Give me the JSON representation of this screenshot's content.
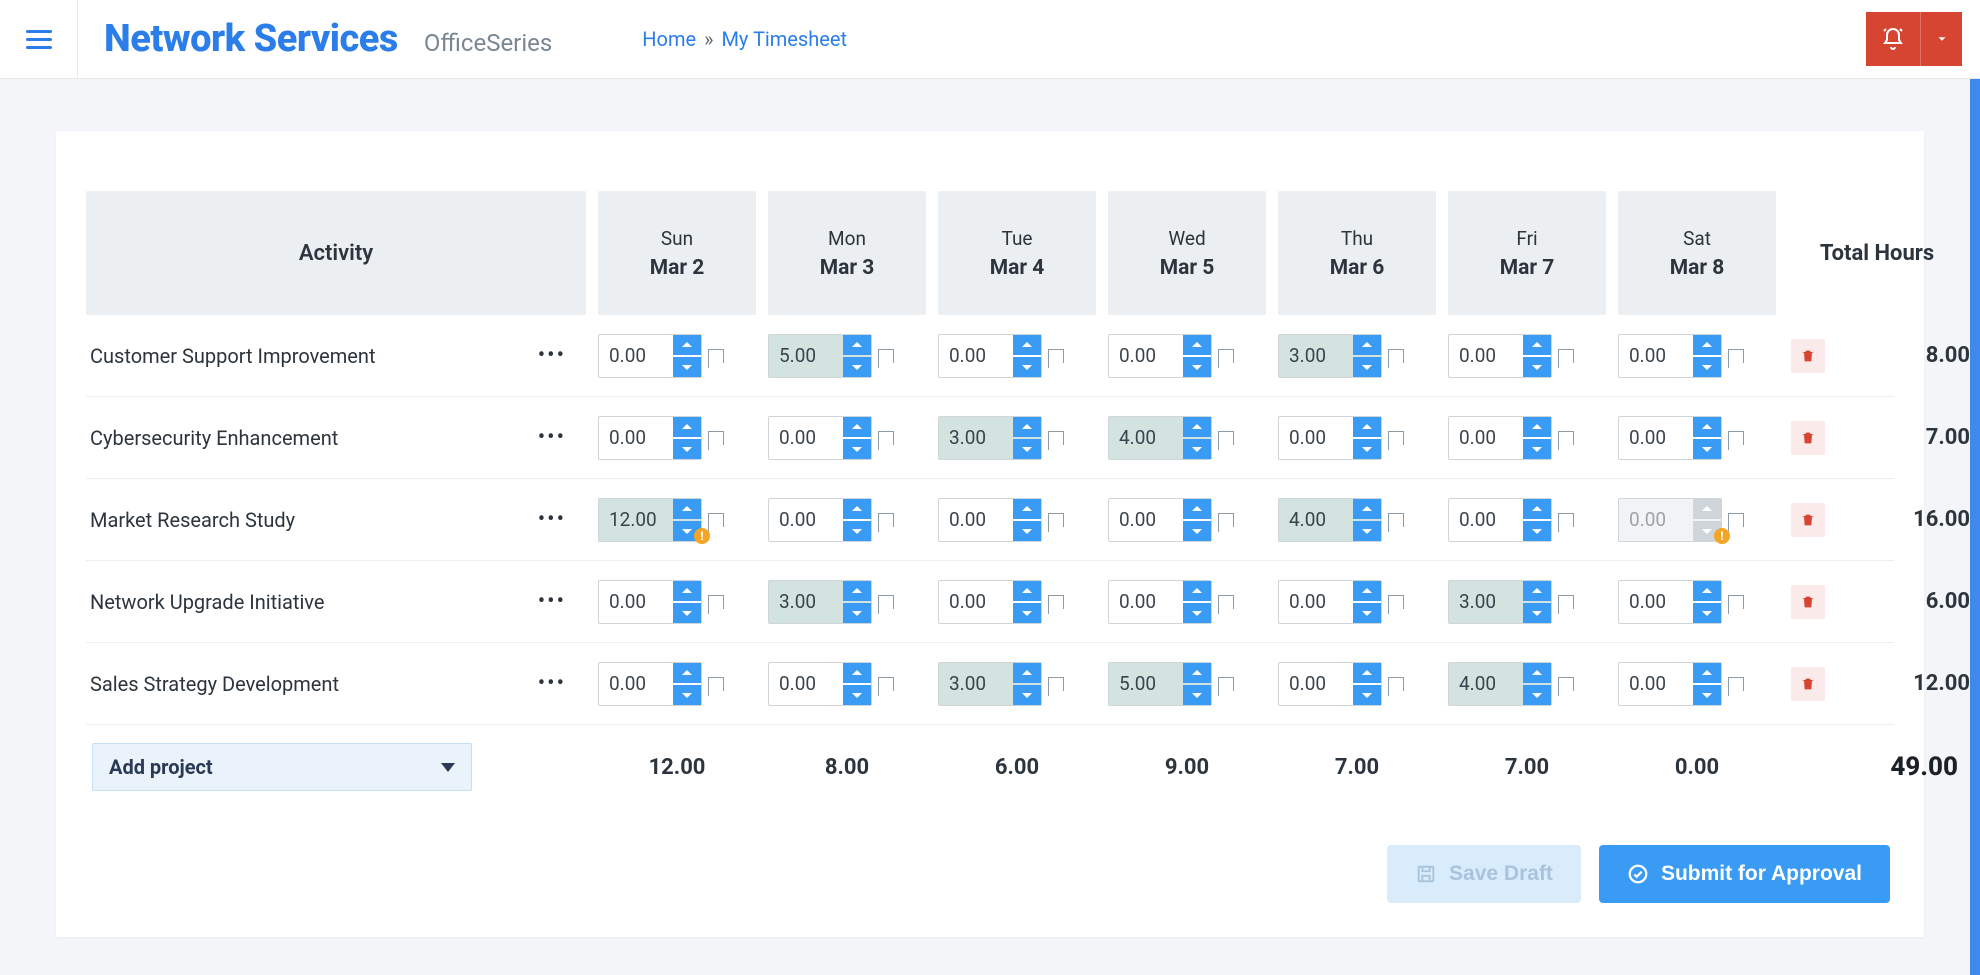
{
  "header": {
    "brand_main": "Network Services",
    "brand_sub": "OfficeSeries",
    "breadcrumb": {
      "home": "Home",
      "sep": "»",
      "current": "My Timesheet"
    }
  },
  "table": {
    "activity_header": "Activity",
    "total_header": "Total Hours",
    "days": [
      {
        "dow": "Sun",
        "date": "Mar 2"
      },
      {
        "dow": "Mon",
        "date": "Mar 3"
      },
      {
        "dow": "Tue",
        "date": "Mar 4"
      },
      {
        "dow": "Wed",
        "date": "Mar 5"
      },
      {
        "dow": "Thu",
        "date": "Mar 6"
      },
      {
        "dow": "Fri",
        "date": "Mar 7"
      },
      {
        "dow": "Sat",
        "date": "Mar 8"
      }
    ],
    "rows": [
      {
        "name": "Customer Support Improvement",
        "cells": [
          {
            "v": "0.00",
            "filled": false,
            "disabled": false,
            "warn": false
          },
          {
            "v": "5.00",
            "filled": true,
            "disabled": false,
            "warn": false
          },
          {
            "v": "0.00",
            "filled": false,
            "disabled": false,
            "warn": false
          },
          {
            "v": "0.00",
            "filled": false,
            "disabled": false,
            "warn": false
          },
          {
            "v": "3.00",
            "filled": true,
            "disabled": false,
            "warn": false
          },
          {
            "v": "0.00",
            "filled": false,
            "disabled": false,
            "warn": false
          },
          {
            "v": "0.00",
            "filled": false,
            "disabled": false,
            "warn": false
          }
        ],
        "total": "8.00"
      },
      {
        "name": "Cybersecurity Enhancement",
        "cells": [
          {
            "v": "0.00",
            "filled": false,
            "disabled": false,
            "warn": false
          },
          {
            "v": "0.00",
            "filled": false,
            "disabled": false,
            "warn": false
          },
          {
            "v": "3.00",
            "filled": true,
            "disabled": false,
            "warn": false
          },
          {
            "v": "4.00",
            "filled": true,
            "disabled": false,
            "warn": false
          },
          {
            "v": "0.00",
            "filled": false,
            "disabled": false,
            "warn": false
          },
          {
            "v": "0.00",
            "filled": false,
            "disabled": false,
            "warn": false
          },
          {
            "v": "0.00",
            "filled": false,
            "disabled": false,
            "warn": false
          }
        ],
        "total": "7.00"
      },
      {
        "name": "Market Research Study",
        "cells": [
          {
            "v": "12.00",
            "filled": true,
            "disabled": false,
            "warn": true
          },
          {
            "v": "0.00",
            "filled": false,
            "disabled": false,
            "warn": false
          },
          {
            "v": "0.00",
            "filled": false,
            "disabled": false,
            "warn": false
          },
          {
            "v": "0.00",
            "filled": false,
            "disabled": false,
            "warn": false
          },
          {
            "v": "4.00",
            "filled": true,
            "disabled": false,
            "warn": false
          },
          {
            "v": "0.00",
            "filled": false,
            "disabled": false,
            "warn": false
          },
          {
            "v": "0.00",
            "filled": false,
            "disabled": true,
            "warn": true
          }
        ],
        "total": "16.00"
      },
      {
        "name": "Network Upgrade Initiative",
        "cells": [
          {
            "v": "0.00",
            "filled": false,
            "disabled": false,
            "warn": false
          },
          {
            "v": "3.00",
            "filled": true,
            "disabled": false,
            "warn": false
          },
          {
            "v": "0.00",
            "filled": false,
            "disabled": false,
            "warn": false
          },
          {
            "v": "0.00",
            "filled": false,
            "disabled": false,
            "warn": false
          },
          {
            "v": "0.00",
            "filled": false,
            "disabled": false,
            "warn": false
          },
          {
            "v": "3.00",
            "filled": true,
            "disabled": false,
            "warn": false
          },
          {
            "v": "0.00",
            "filled": false,
            "disabled": false,
            "warn": false
          }
        ],
        "total": "6.00"
      },
      {
        "name": "Sales Strategy Development",
        "cells": [
          {
            "v": "0.00",
            "filled": false,
            "disabled": false,
            "warn": false
          },
          {
            "v": "0.00",
            "filled": false,
            "disabled": false,
            "warn": false
          },
          {
            "v": "3.00",
            "filled": true,
            "disabled": false,
            "warn": false
          },
          {
            "v": "5.00",
            "filled": true,
            "disabled": false,
            "warn": false
          },
          {
            "v": "0.00",
            "filled": false,
            "disabled": false,
            "warn": false
          },
          {
            "v": "4.00",
            "filled": true,
            "disabled": false,
            "warn": false
          },
          {
            "v": "0.00",
            "filled": false,
            "disabled": false,
            "warn": false
          }
        ],
        "total": "12.00"
      }
    ],
    "col_totals": [
      "12.00",
      "8.00",
      "6.00",
      "9.00",
      "7.00",
      "7.00",
      "0.00"
    ],
    "grand_total": "49.00",
    "add_project_label": "Add project"
  },
  "actions": {
    "save_label": "Save Draft",
    "submit_label": "Submit for Approval"
  }
}
